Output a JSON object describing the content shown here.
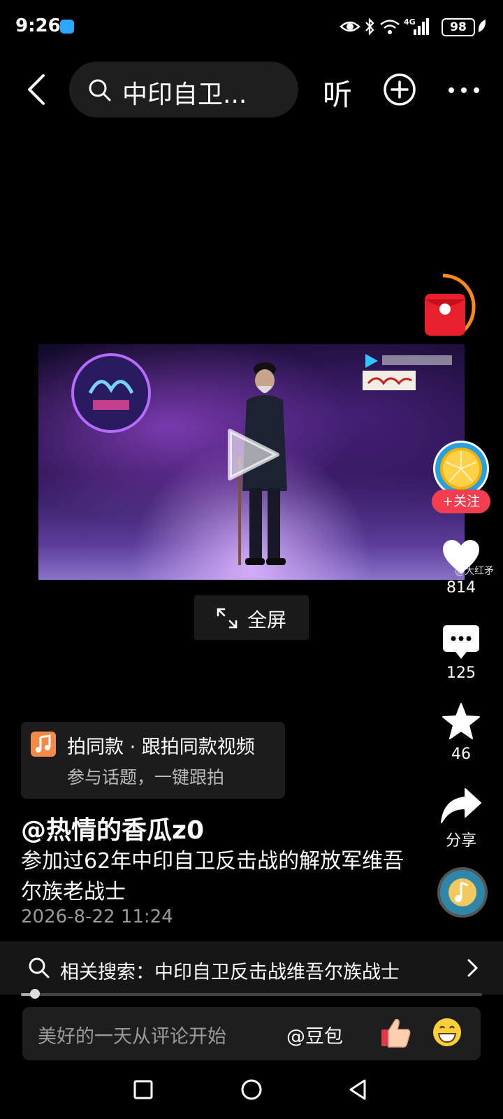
{
  "status_bar": {
    "time": "9:26",
    "battery": "98"
  },
  "header": {
    "search_text": "中印自卫...",
    "listen_label": "听"
  },
  "video": {
    "fullscreen_label": "全屏",
    "watermark": "@大红矛"
  },
  "side_rail": {
    "follow_label": "+关注",
    "like_count": "814",
    "comment_count": "125",
    "favorite_count": "46",
    "share_label": "分享"
  },
  "post": {
    "template_title": "拍同款 · 跟拍同款视频",
    "template_subtitle": "参与话题，一键跟拍",
    "author": "@热情的香瓜z0",
    "description": "参加过62年中印自卫反击战的解放军维吾尔族老战士",
    "date": "2026-8-22 11:24"
  },
  "related_search": {
    "text": "相关搜索：中印自卫反击战维吾尔族战士"
  },
  "playback": {
    "progress": 0.03
  },
  "comment_bar": {
    "placeholder": "美好的一天从评论开始",
    "mention": "@豆包"
  }
}
